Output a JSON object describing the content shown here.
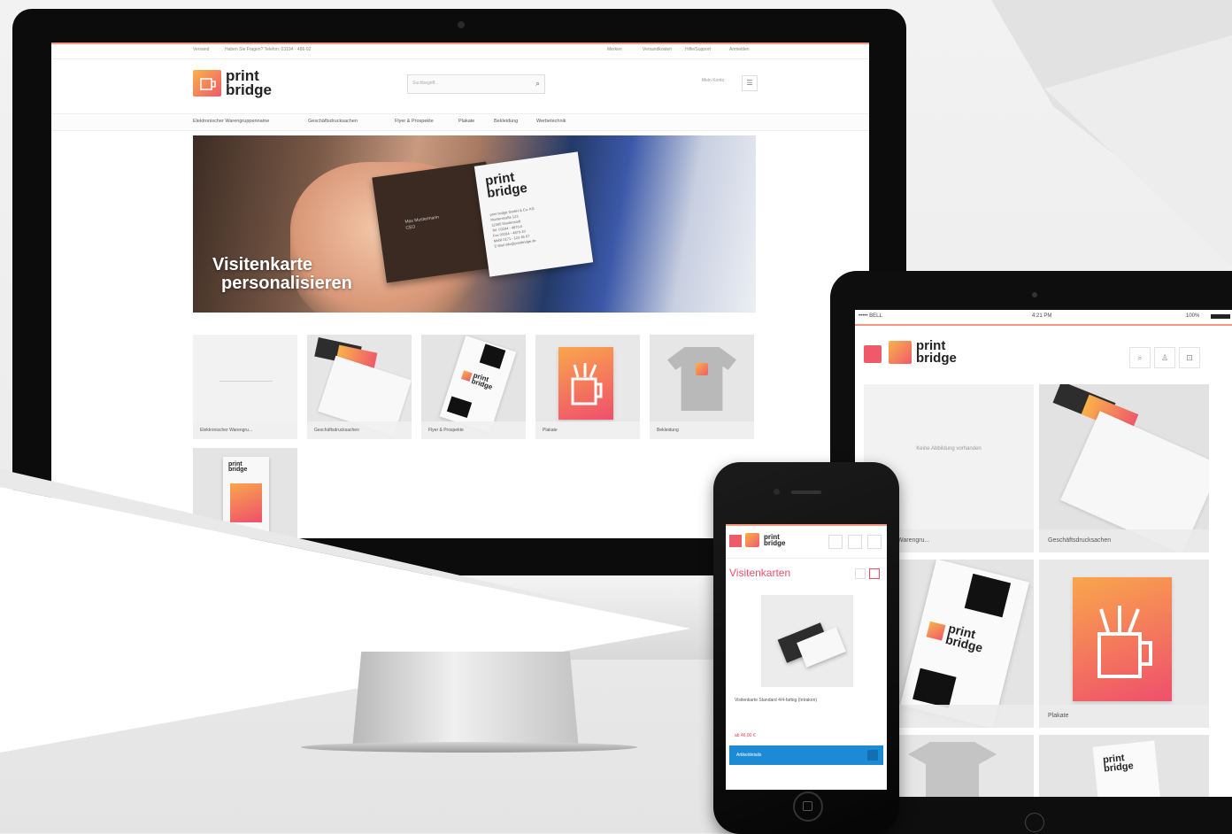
{
  "desktop": {
    "topbar": {
      "left1": "Versand",
      "left2": "Haben Sie Fragen? Telefon: 03194 - 486-92",
      "right1": "Merken",
      "right2": "Versandkosten",
      "right3": "Hilfe/Support",
      "right4": "Anmelden"
    },
    "logo": {
      "line1": "print",
      "line2": "bridge"
    },
    "search_placeholder": "Suchbegriff...",
    "account_label": "Mein Konto",
    "nav": [
      "Elektronischer Warengruppenname",
      "Geschäftsdrucksachen",
      "Flyer & Prospekte",
      "Plakate",
      "Bekleidung",
      "Werbetechnik"
    ],
    "hero": {
      "title_line1": "Visitenkarte",
      "title_line2": "personalisieren",
      "card_dark_name": "Max Mustermann",
      "card_dark_role": "CEO",
      "card_logo_line1": "print",
      "card_logo_line2": "bridge",
      "card_address1": "print bridge GmbH & Co. KG",
      "card_address2": "Musterstraße 123",
      "card_address3": "12345 Musterstadt",
      "card_phone": "Tel. 03194 - 4870-0",
      "card_fax": "Fax 03194 - 4870-10",
      "card_mobil": "Mobil 0171 - 123 45 67",
      "card_email": "E-Mail info@printbridge.de"
    },
    "tiles": [
      "Elektronischer Warengru...",
      "Geschäftsdrucksachen",
      "Flyer & Prospekte",
      "Plakate",
      "Bekleidung"
    ]
  },
  "tablet": {
    "status": {
      "carrier": "••••• BELL",
      "time": "4:21 PM",
      "battery": "100%"
    },
    "logo": {
      "line1": "print",
      "line2": "bridge"
    },
    "tiles": [
      "...ranger Warengru...",
      "Geschäftsdrucksachen",
      "...ospekte",
      "Plakate"
    ],
    "placeholder": "Keine Abbildung vorhanden"
  },
  "phone": {
    "logo": {
      "line1": "print",
      "line2": "bridge"
    },
    "page_title": "Visitenkarten",
    "product_desc": "Visitenkarte Standard 4/4-farbig (Intrakon)",
    "price": "ab 46,00 €",
    "cta": "Artikeldetails"
  },
  "colors": {
    "accent": "#f09a82",
    "gradient_start": "#f9b24a",
    "gradient_end": "#ef5a6a",
    "cta": "#1d8ad6"
  }
}
